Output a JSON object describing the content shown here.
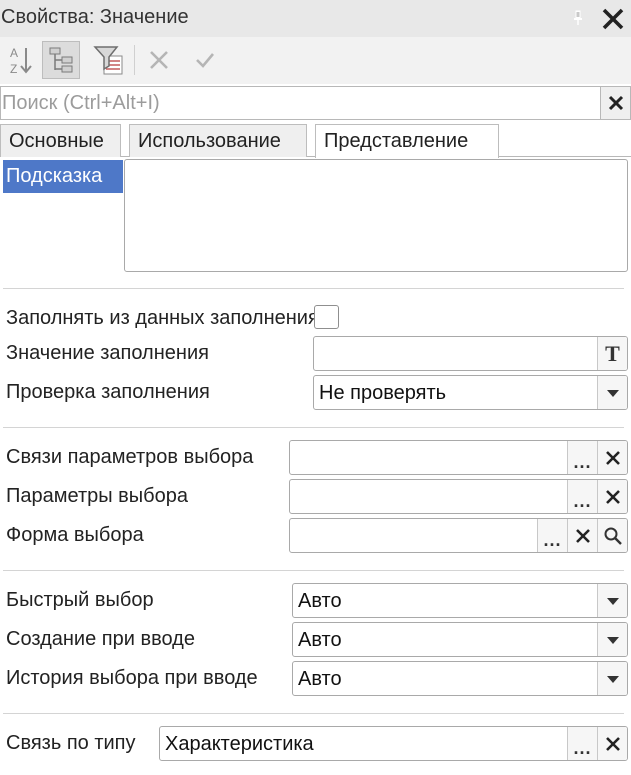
{
  "window": {
    "title": "Свойства: Значение"
  },
  "toolbar": {
    "icons": [
      "sort-az-icon",
      "tree-view-icon",
      "filter-icon",
      "cancel-icon",
      "check-icon"
    ]
  },
  "search": {
    "placeholder": "Поиск (Ctrl+Alt+I)",
    "value": ""
  },
  "tabs": [
    {
      "label": "Основные",
      "active": false
    },
    {
      "label": "Использование",
      "active": false
    },
    {
      "label": "Представление",
      "active": true
    }
  ],
  "sidebar": {
    "items": [
      {
        "label": "Подсказка",
        "selected": true
      }
    ]
  },
  "hint": {
    "value": ""
  },
  "fill_group": {
    "fill_from_data_label": "Заполнять из данных заполнения",
    "fill_from_data_checked": false,
    "fill_value_label": "Значение заполнения",
    "fill_value": "",
    "fill_check_label": "Проверка заполнения",
    "fill_check_value": "Не проверять"
  },
  "choice_group": {
    "params_links_label": "Связи параметров выбора",
    "params_links_value": "",
    "params_label": "Параметры выбора",
    "params_value": "",
    "form_label": "Форма выбора",
    "form_value": ""
  },
  "quick_group": {
    "quick_choice_label": "Быстрый выбор",
    "quick_choice_value": "Авто",
    "create_on_input_label": "Создание при вводе",
    "create_on_input_value": "Авто",
    "history_label": "История выбора при вводе",
    "history_value": "Авто"
  },
  "type_group": {
    "type_link_label": "Связь по типу",
    "type_link_value": "Характеристика"
  }
}
